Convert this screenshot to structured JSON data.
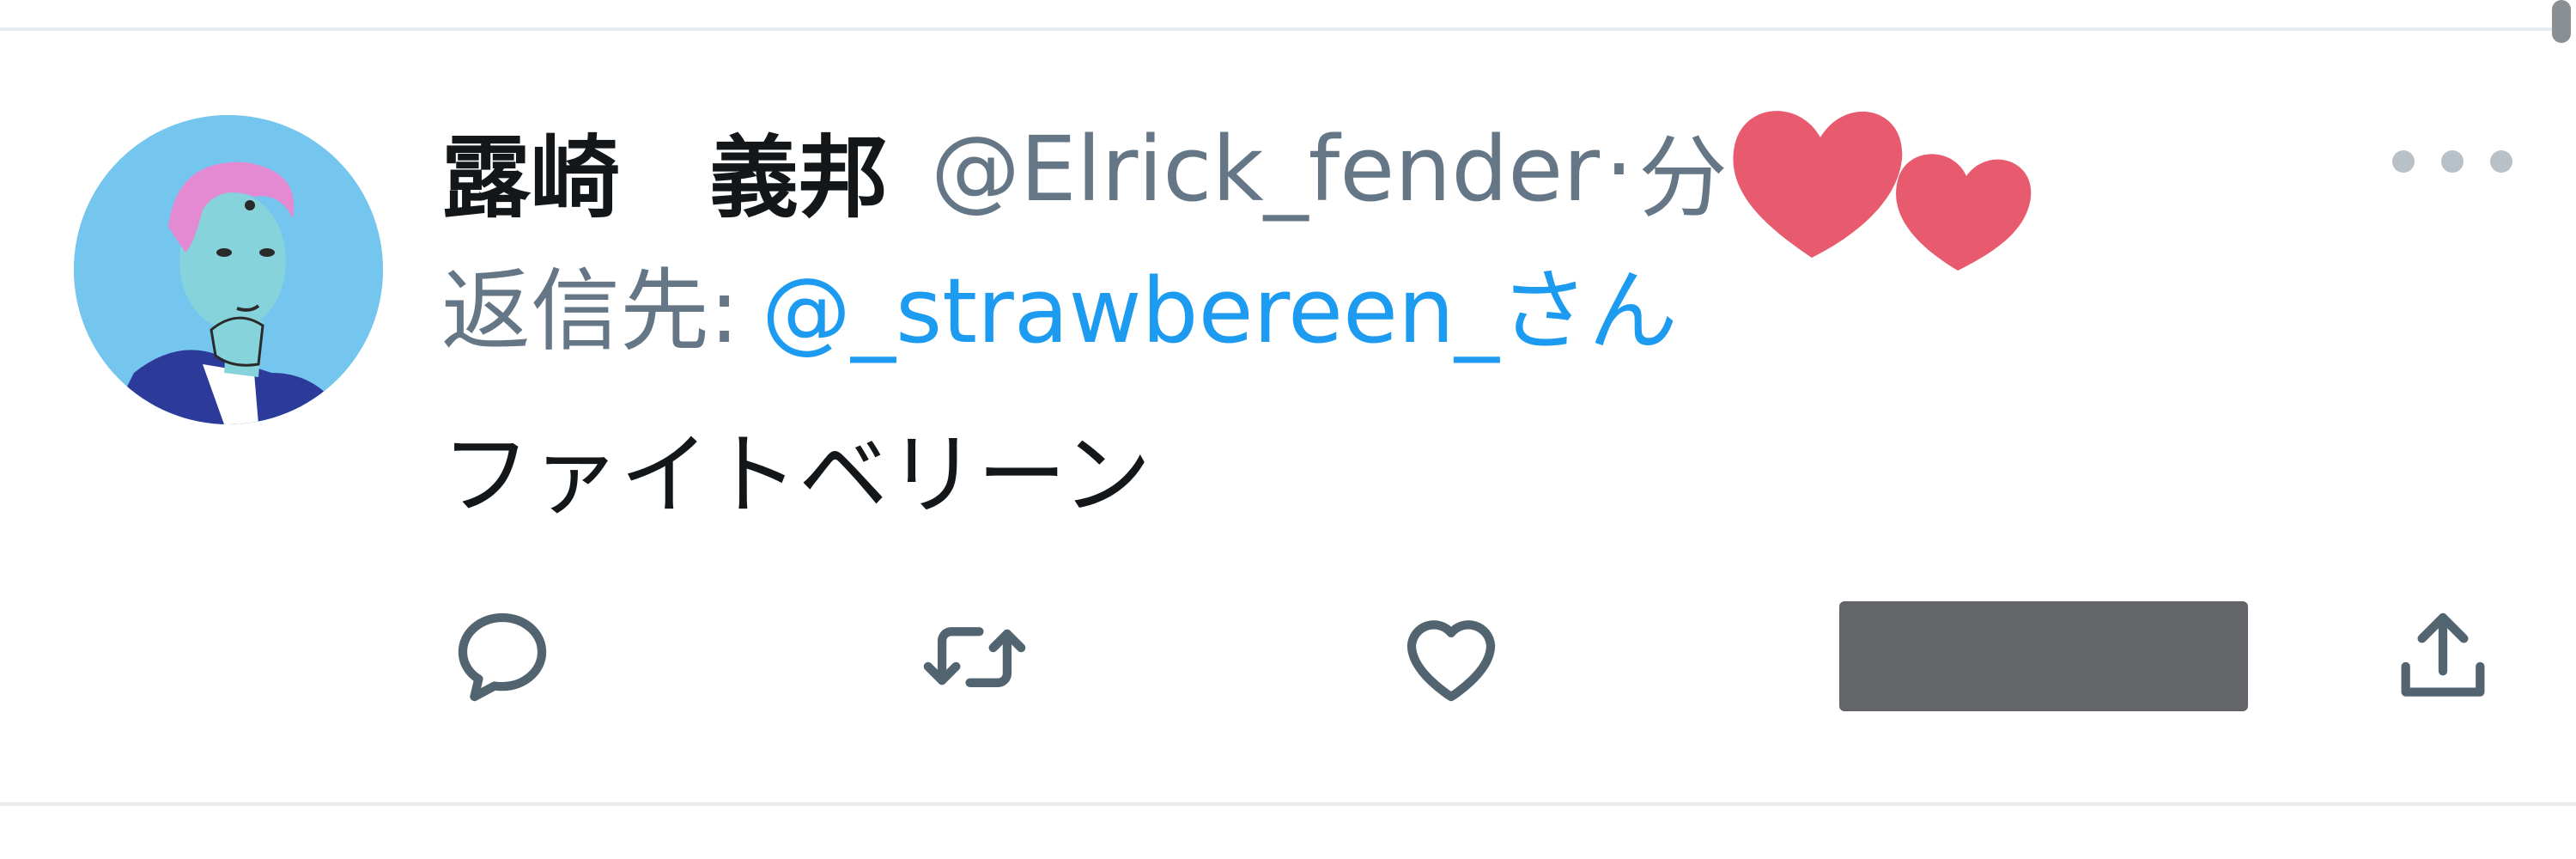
{
  "tweet": {
    "display_name": "露崎　義邦",
    "handle": "@Elrick_fender",
    "separator": "·",
    "time": "分",
    "reply_label": "返信先:",
    "reply_target": "@_strawbereen_さん",
    "text": "ファイトベリーン"
  },
  "icons": {
    "avatar": "illustrated-avatar",
    "more": "more-horizontal-icon",
    "reply": "reply-icon",
    "retweet": "retweet-icon",
    "like": "heart-icon",
    "share": "share-icon",
    "stickers": "heart-sticker-icon"
  },
  "colors": {
    "link": "#1d9bf0",
    "secondary_text": "#657786",
    "primary_text": "#14171a",
    "heart_sticker": "#e85a6e",
    "redaction": "#636569"
  }
}
